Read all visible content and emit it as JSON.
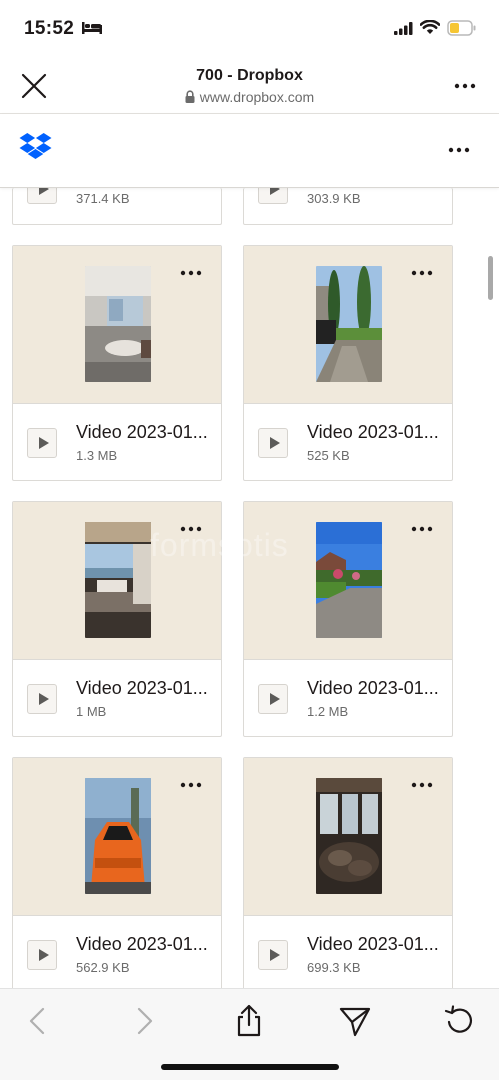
{
  "status_bar": {
    "time": "15:52"
  },
  "browser": {
    "title": "700 - Dropbox",
    "url": "www.dropbox.com"
  },
  "files": [
    {
      "name": "",
      "size": "371.4 KB"
    },
    {
      "name": "",
      "size": "303.9 KB"
    },
    {
      "name": "Video 2023-01...",
      "size": "1.3 MB"
    },
    {
      "name": "Video 2023-01...",
      "size": "525 KB"
    },
    {
      "name": "Video 2023-01...",
      "size": "1 MB"
    },
    {
      "name": "Video 2023-01...",
      "size": "1.2 MB"
    },
    {
      "name": "Video 2023-01...",
      "size": "562.9 KB"
    },
    {
      "name": "Video 2023-01...",
      "size": "699.3 KB"
    }
  ],
  "watermark": "formsotis",
  "icons": {
    "close": "close-icon",
    "lock": "lock-icon",
    "more": "more-horizontal-icon",
    "logo": "dropbox-logo",
    "play": "play-icon",
    "back": "chevron-left-icon",
    "forward": "chevron-right-icon",
    "share": "share-icon",
    "send": "send-icon",
    "reload": "reload-icon"
  },
  "colors": {
    "thumb_background": "#f0e9dc",
    "dropbox_blue": "#0061fe"
  }
}
